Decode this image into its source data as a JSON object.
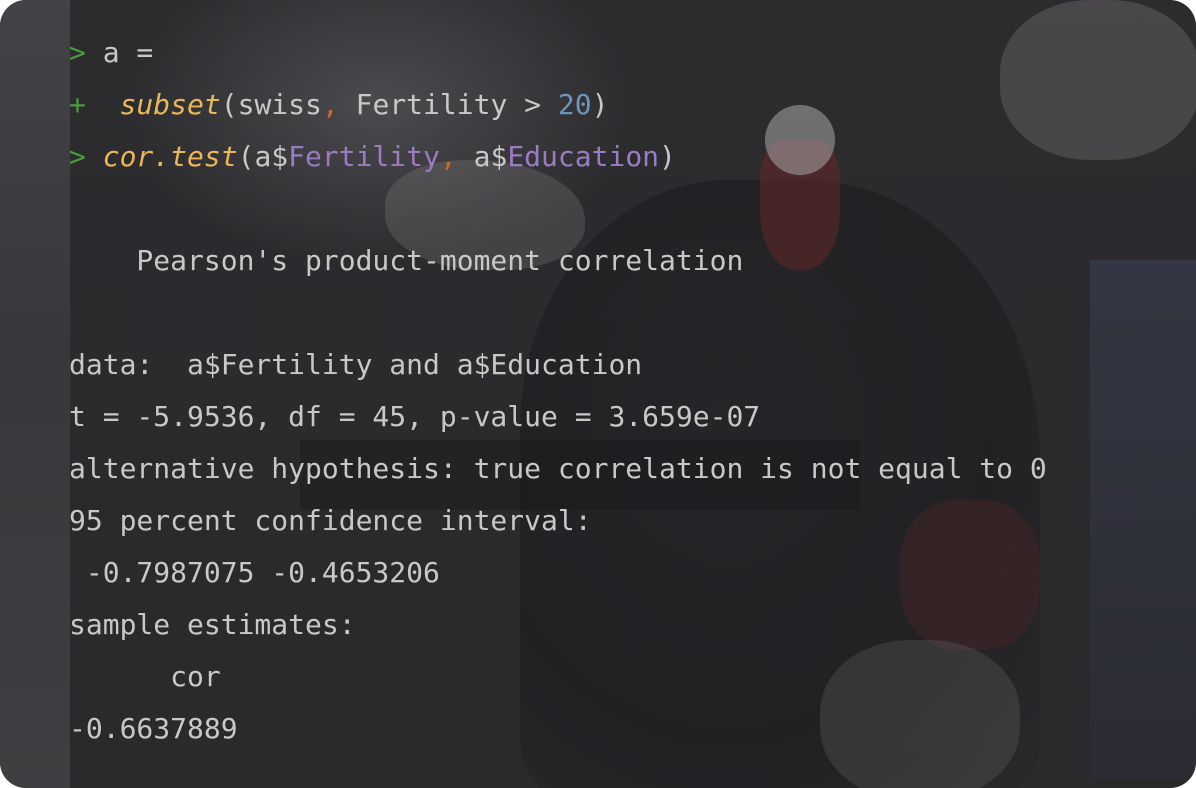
{
  "console": {
    "prompt_symbol": ">",
    "continuation_symbol": "+",
    "input": {
      "line1": {
        "code": "a ="
      },
      "line2": {
        "fn": "subset",
        "open": "(",
        "arg1": "swiss",
        "comma": ",",
        "cond_lhs": " Fertility > ",
        "cond_num": "20",
        "close": ")"
      },
      "line3": {
        "fn": "cor.test",
        "open": "(",
        "a1_obj": "a$",
        "a1_field": "Fertility",
        "comma": ",",
        "a2_obj": " a$",
        "a2_field": "Education",
        "close": ")"
      }
    },
    "output": {
      "method": "    Pearson's product-moment correlation",
      "data_line": "data:  a$Fertility and a$Education",
      "stats_line": "t = -5.9536, df = 45, p-value = 3.659e-07",
      "alt_line": "alternative hypothesis: true correlation is not equal to 0",
      "ci_label": "95 percent confidence interval:",
      "ci_values": " -0.7987075 -0.4653206",
      "est_label": "sample estimates:",
      "est_name": "      cor",
      "est_value": "-0.6637889"
    }
  },
  "colors": {
    "prompt": "#4a9d3f",
    "function": "#e8b75a",
    "number": "#6c96b8",
    "field": "#9b7bc2",
    "comma": "#c5682e",
    "text": "#c9c8c6"
  }
}
